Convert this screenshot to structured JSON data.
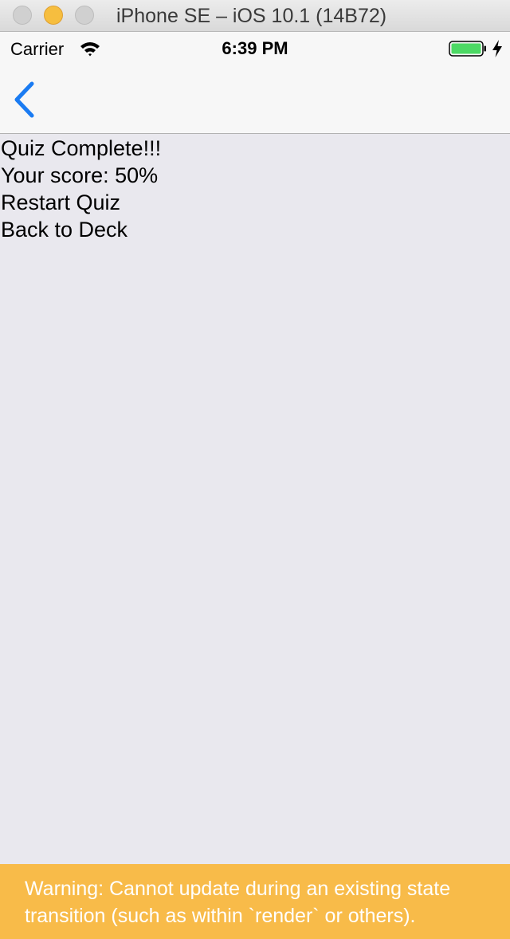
{
  "window": {
    "title": "iPhone SE – iOS 10.1 (14B72)",
    "buttons": [
      "close",
      "minimize",
      "zoom"
    ]
  },
  "status_bar": {
    "carrier": "Carrier",
    "time": "6:39 PM",
    "wifi_icon": "wifi-icon",
    "battery_icon": "battery-icon",
    "battery_color": "#4cd964",
    "charging": true
  },
  "nav_bar": {
    "back_icon": "chevron-left-icon",
    "tint_color": "#1a7bf2"
  },
  "quiz_result": {
    "heading": "Quiz Complete!!!",
    "score": "Your score: 50%",
    "restart_label": "Restart Quiz",
    "back_label": "Back to Deck"
  },
  "warning_box": {
    "text": "Warning: Cannot update during an existing state transition (such as within `render` or others).",
    "color": "#f8bb49"
  }
}
